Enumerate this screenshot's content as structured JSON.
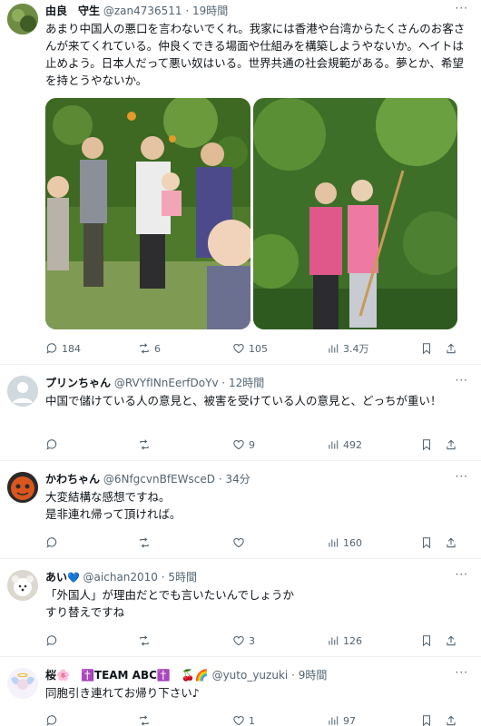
{
  "posts": [
    {
      "name": "由良　守生",
      "handle": "@zan4736511",
      "time": "· 19時間",
      "text": "あまり中国人の悪口を言わないでくれ。我家には香港や台湾からたくさんのお客さんが来てくれている。仲良くできる場面や仕組みを構築しようやないか。ヘイトは止めよう。日本人だって悪い奴はいる。世界共通の社会規範がある。夢とか、希望を持とうやないか。",
      "reply_count": "184",
      "repost_count": "6",
      "like_count": "105",
      "view_count": "3.4万"
    },
    {
      "name": "プリンちゃん",
      "handle": "@RVYfINnEerfDoYv",
      "time": "· 12時間",
      "text": "中国で儲けている人の意見と、被害を受けている人の意見と、どっちが重い！",
      "reply_count": "",
      "repost_count": "",
      "like_count": "9",
      "view_count": "492"
    },
    {
      "name": "かわちゃん",
      "handle": "@6NfgcvnBfEWsceD",
      "time": "· 34分",
      "text": "大変結構な感想ですね。\n是非連れ帰って頂ければ。",
      "reply_count": "",
      "repost_count": "",
      "like_count": "",
      "view_count": "160"
    },
    {
      "name": "あい",
      "name_badge": "💙",
      "handle": "@aichan2010",
      "time": "· 5時間",
      "text": "「外国人」が理由だとでも言いたいんでしょうか\nすり替えですね",
      "reply_count": "",
      "repost_count": "",
      "like_count": "3",
      "view_count": "126"
    },
    {
      "name": "桜🌸　✝️TEAM ABC✝️　🍒🌈",
      "handle": "@yuto_yuzuki",
      "time": "· 9時間",
      "text": "同胞引き連れてお帰り下さい♪",
      "reply_count": "",
      "repost_count": "",
      "like_count": "1",
      "view_count": "97"
    }
  ],
  "icons": {
    "reply": "reply-icon",
    "repost": "repost-icon",
    "like": "heart-icon",
    "views": "views-icon",
    "bookmark": "bookmark-icon",
    "share": "share-icon",
    "more": "more-icon"
  },
  "colors": {
    "text": "#0f1419",
    "muted": "#536471",
    "divider": "#eff3f4",
    "foliage": "#4f7a2c",
    "shirt_pink": "#e0588a"
  }
}
